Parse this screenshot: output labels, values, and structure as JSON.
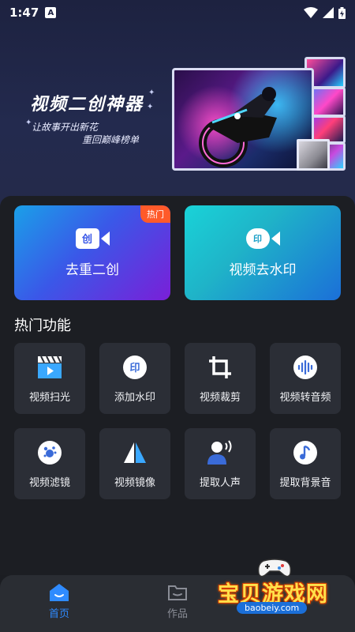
{
  "status_bar": {
    "time": "1:47",
    "a_icon": "A"
  },
  "banner": {
    "title": "视频二创神器",
    "subtitle_line1": "让故事开出新花",
    "subtitle_line2": "重回巅峰榜单"
  },
  "primary_actions": [
    {
      "label": "去重二创",
      "icon_char": "创",
      "badge": "热门"
    },
    {
      "label": "视频去水印",
      "icon_char": "印"
    }
  ],
  "section_title": "热门功能",
  "features": [
    {
      "label": "视频扫光",
      "icon": "clapperboard-play-icon"
    },
    {
      "label": "添加水印",
      "icon": "watermark-stamp-icon"
    },
    {
      "label": "视频裁剪",
      "icon": "crop-icon"
    },
    {
      "label": "视频转音频",
      "icon": "audio-waveform-icon"
    },
    {
      "label": "视频滤镜",
      "icon": "filter-icon"
    },
    {
      "label": "视频镜像",
      "icon": "mirror-icon"
    },
    {
      "label": "提取人声",
      "icon": "voice-person-icon"
    },
    {
      "label": "提取背景音",
      "icon": "music-note-icon"
    }
  ],
  "bottom_nav": [
    {
      "label": "首页",
      "active": true
    },
    {
      "label": "作品",
      "active": false
    }
  ],
  "watermark": {
    "text": "宝贝游戏网",
    "url": "baobeiy.com"
  },
  "colors": {
    "accent": "#2f8bff",
    "hot_badge": "#ff5a2a",
    "tile_bg": "#2b2e36"
  }
}
